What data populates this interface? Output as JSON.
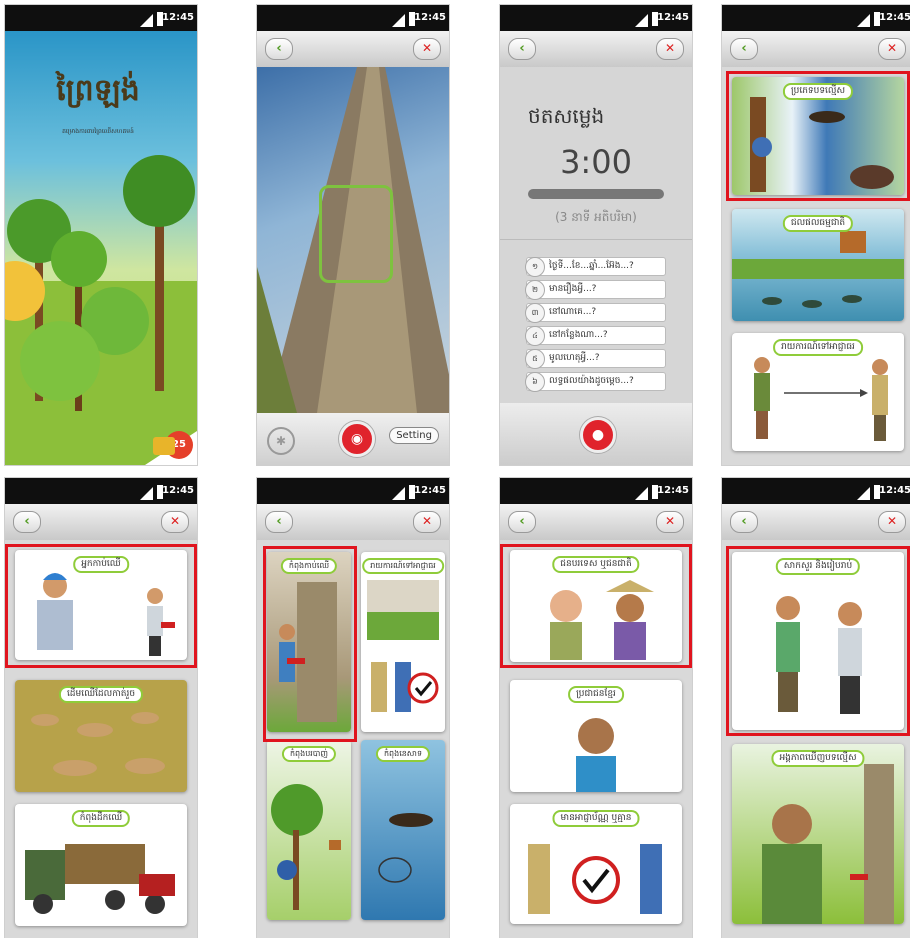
{
  "status": {
    "time": "12:45"
  },
  "colors": {
    "accent_green": "#8fcc3a",
    "highlight_red": "#e0141e",
    "record_red": "#e0232c"
  },
  "screens": {
    "cover": {
      "title": "ព្រៃឡង់",
      "subtitle": "គម្រោងការពារព្រៃឈើសហគមន៍",
      "badge": "25"
    },
    "camera": {
      "setting_label": "Setting"
    },
    "record": {
      "heading": "ថតសម្លេង",
      "timer": "3:00",
      "limit": "(3 នាទី អតិបរិមា)",
      "questions": [
        {
          "num": "១",
          "text": "ថ្ងៃទី...ខែ...ឆ្នាំ...អ៊ែង...?"
        },
        {
          "num": "២",
          "text": "មានរឿងអ្វី...?"
        },
        {
          "num": "៣",
          "text": "នៅណាគេ...?"
        },
        {
          "num": "៤",
          "text": "នៅកន្លែងណា...?"
        },
        {
          "num": "៥",
          "text": "មូលហេតុអ្វី...?"
        },
        {
          "num": "៦",
          "text": "លទ្ធផលយ៉ាងដូចម្តេច...?"
        }
      ]
    },
    "menu1": {
      "cards": [
        "ប្រភេទបទល្មើស",
        "ជលផលធម្មជាតិ",
        "រាយការណ៍ទៅអាជ្ញាធរ"
      ]
    },
    "menu2": {
      "cards": [
        "អ្នកកាប់ឈើ",
        "ដើមឈើដែលកាត់រួច",
        "កំពុងដឹកឈើ"
      ]
    },
    "menu3": {
      "cards": [
        "កំពុងកាប់ឈើ",
        "រាយការណ៍ទៅអាជ្ញាធរ",
        "កំពុងបរបាញ់",
        "កំពុងនេសាទ"
      ]
    },
    "menu4": {
      "cards": [
        "ជនបរទេស ឬជនជាតិ",
        "ប្រជាជនខ្មែរ",
        "មានអាជ្ញាប័ណ្ណ ឬគ្មាន"
      ]
    },
    "menu5": {
      "cards": [
        "សាកសួរ និងរៀបរាប់",
        "អង្គភាពឃើញបទល្មើស"
      ]
    }
  }
}
